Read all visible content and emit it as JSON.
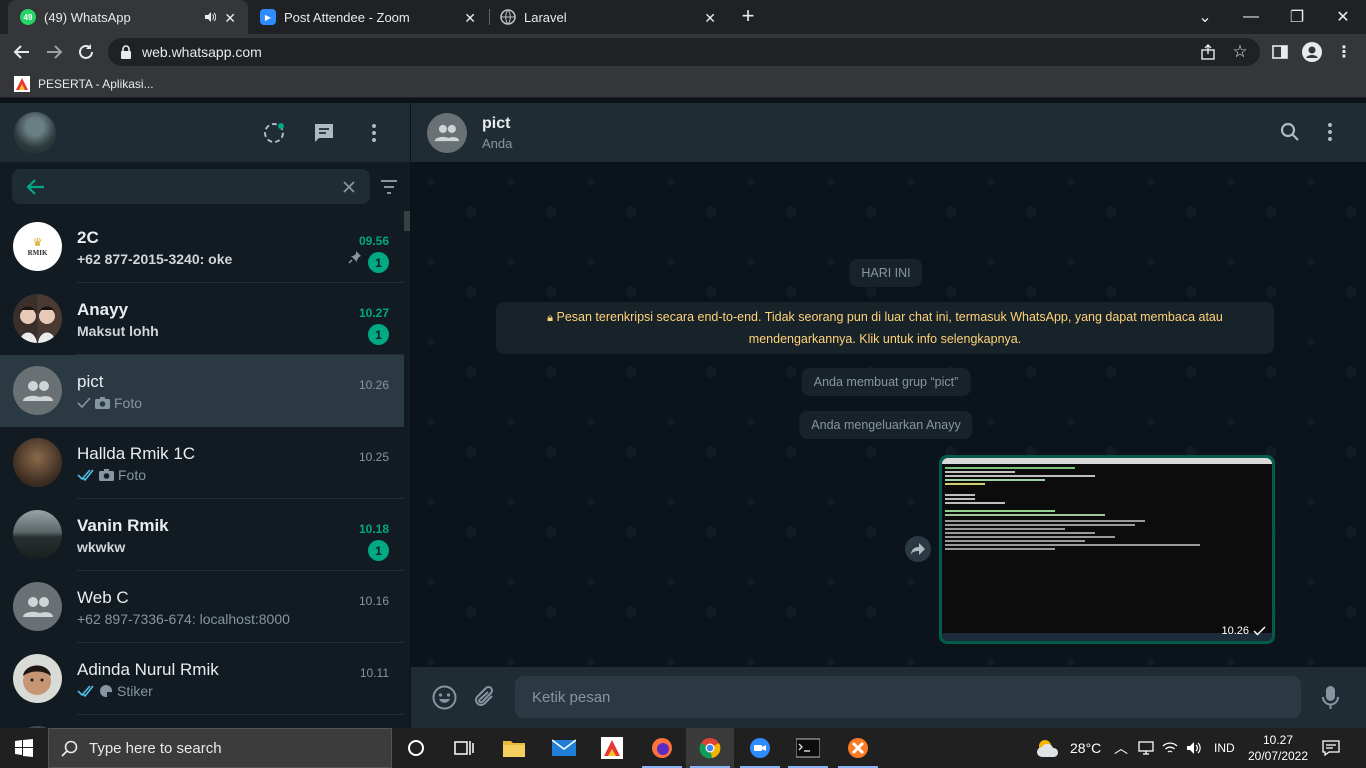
{
  "browser": {
    "tabs": [
      {
        "title": "(49) WhatsApp",
        "badge": "49",
        "active": true
      },
      {
        "title": "Post Attendee - Zoom",
        "active": false
      },
      {
        "title": "Laravel",
        "active": false
      }
    ],
    "url": "web.whatsapp.com",
    "bookmark_label": "PESERTA - Aplikasi..."
  },
  "sidebar": {
    "search_value": "",
    "chats": [
      {
        "name": "2C",
        "preview": "+62 877-2015-3240: oke",
        "time": "09.56",
        "unread": "1",
        "pinned": true,
        "bold": true,
        "avatar_text": "RMIK"
      },
      {
        "name": "Anayy",
        "preview": "Maksut lohh",
        "time": "10.27",
        "unread": "1",
        "bold": true
      },
      {
        "name": "pict",
        "preview": "Foto",
        "time": "10.26",
        "selected": true,
        "tick": "single",
        "media": "camera"
      },
      {
        "name": "Hallda Rmik 1C",
        "preview": "Foto",
        "time": "10.25",
        "tick": "double-blue",
        "media": "camera"
      },
      {
        "name": "Vanin Rmik",
        "preview": "wkwkw",
        "time": "10.18",
        "unread": "1",
        "bold": true
      },
      {
        "name": "Web C",
        "preview": "+62 897-7336-674: localhost:8000",
        "time": "10.16"
      },
      {
        "name": "Adinda Nurul Rmik",
        "preview": "Stiker",
        "time": "10.11",
        "tick": "double-blue",
        "media": "sticker"
      }
    ]
  },
  "conversation": {
    "name": "pict",
    "subtitle": "Anda",
    "date_chip": "HARI INI",
    "encryption_notice": "Pesan terenkripsi secara end-to-end. Tidak seorang pun di luar chat ini, termasuk WhatsApp, yang dapat membaca atau mendengarkannya. Klik untuk info selengkapnya.",
    "system_messages": [
      "Anda membuat grup “pict”",
      "Anda mengeluarkan Anayy"
    ],
    "image_message": {
      "time": "10.26",
      "status": "sent"
    },
    "compose_placeholder": "Ketik pesan"
  },
  "taskbar": {
    "search_placeholder": "Type here to search",
    "weather": "28°C",
    "language": "IND",
    "clock_time": "10.27",
    "clock_date": "20/07/2022"
  },
  "colors": {
    "accent": "#00a884",
    "panel": "#202c33",
    "bg": "#111b21",
    "notice": "#ffd279",
    "outgoing": "#005c4b"
  }
}
